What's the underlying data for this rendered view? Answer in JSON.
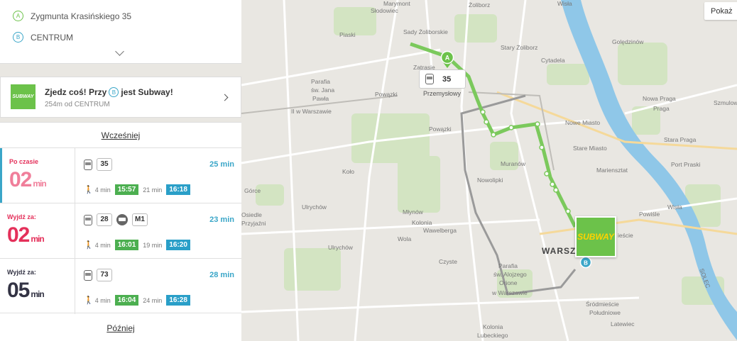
{
  "route": {
    "from_letter": "A",
    "from_label": "Zygmunta Krasińskiego 35",
    "to_letter": "B",
    "to_label": "CENTRUM"
  },
  "promo": {
    "logo_text": "SUBWAY",
    "title_before": "Zjedz coś! Przy",
    "title_letter": "B",
    "title_after": "jest Subway!",
    "subtitle": "254m od CENTRUM"
  },
  "results": {
    "earlier_label": "Wcześniej",
    "later_label": "Później",
    "trips": [
      {
        "status": "Po czasie",
        "status_color": "#f07e9a",
        "minutes": "02",
        "unit": "min",
        "duration": "25 min",
        "lines": [
          {
            "icon": "tram-icon",
            "label": "35"
          }
        ],
        "walk": "4 min",
        "depart": "15:57",
        "ride": "21 min",
        "arrive": "16:18"
      },
      {
        "status": "Wyjdź za:",
        "status_color": "#e4305a",
        "minutes": "02",
        "unit": "min",
        "duration": "23 min",
        "lines": [
          {
            "icon": "tram-icon",
            "label": "28"
          },
          {
            "icon": "metro-icon",
            "label": "M1"
          }
        ],
        "walk": "4 min",
        "depart": "16:01",
        "ride": "19 min",
        "arrive": "16:20"
      },
      {
        "status": "Wyjdź za:",
        "status_color": "#333344",
        "minutes": "05",
        "unit": "min",
        "duration": "28 min",
        "lines": [
          {
            "icon": "tram-icon",
            "label": "73"
          }
        ],
        "walk": "4 min",
        "depart": "16:04",
        "ride": "24 min",
        "arrive": "16:28"
      }
    ]
  },
  "map": {
    "show_button": "Pokaż",
    "stop_line": "35",
    "stop_name": "Przemysłowy",
    "marker_a": "A",
    "marker_b": "B",
    "subway_logo": "SUBWAY",
    "labels": {
      "slodowiec": "Słodowiec",
      "zoliborz": "Żoliborz",
      "sady": "Sady Żoliborskie",
      "piaski": "Piaski",
      "stary_zoliborz": "Stary Żoliborz",
      "cytadela": "Cytadela",
      "zatrasie": "Zatrasie",
      "marymont": "Marymont",
      "parafia1": "Parafia",
      "parafia2": "św. Jana",
      "parafia3": "Pawła",
      "parafia4": "II w Warszawie",
      "powazki": "Powązki",
      "powazki2": "Powązki",
      "kolo": "Koło",
      "muranow": "Muranów",
      "nowolipki": "Nowolipki",
      "nowe_miasto": "Nowe Miasto",
      "stare_miasto": "Stare Miasto",
      "mariensztat": "Mariensztat",
      "stara_praga": "Stara Praga",
      "nowa_praga": "Nowa Praga",
      "praga": "Praga",
      "szmulowizna": "Szmulow",
      "goledzinow": "Golędzinów",
      "port_praski": "Port Praski",
      "gorce": "Górce",
      "ulrychow": "Ulrychów",
      "ulrychow2": "Ulrychów",
      "mlynow": "Młynów",
      "kolonia": "Kolonia",
      "wawelberga": "Wawelberga",
      "wola": "Wola",
      "czyste": "Czyste",
      "osiedle": "Osiedle",
      "przyjazni": "Przyjaźni",
      "warszawa": "WARSZ",
      "parafia_b1": "Parafia",
      "parafia_b2": "św. Alojzego",
      "parafia_b3": "Orione",
      "parafia_b4": "w Warszawie",
      "srodmiescie1": "Śródmieście",
      "srodmiescie2": "Południowe",
      "latewiec": "Latewiec",
      "powisle": "Powiśle",
      "kolonia_lubeckiego": "Kolonia",
      "kolonia_lubeckiego2": "Lubeckiego",
      "wisla": "Wisła",
      "wisla2": "Wisła",
      "solec": "SOLEC",
      "escie": "ieście"
    }
  }
}
